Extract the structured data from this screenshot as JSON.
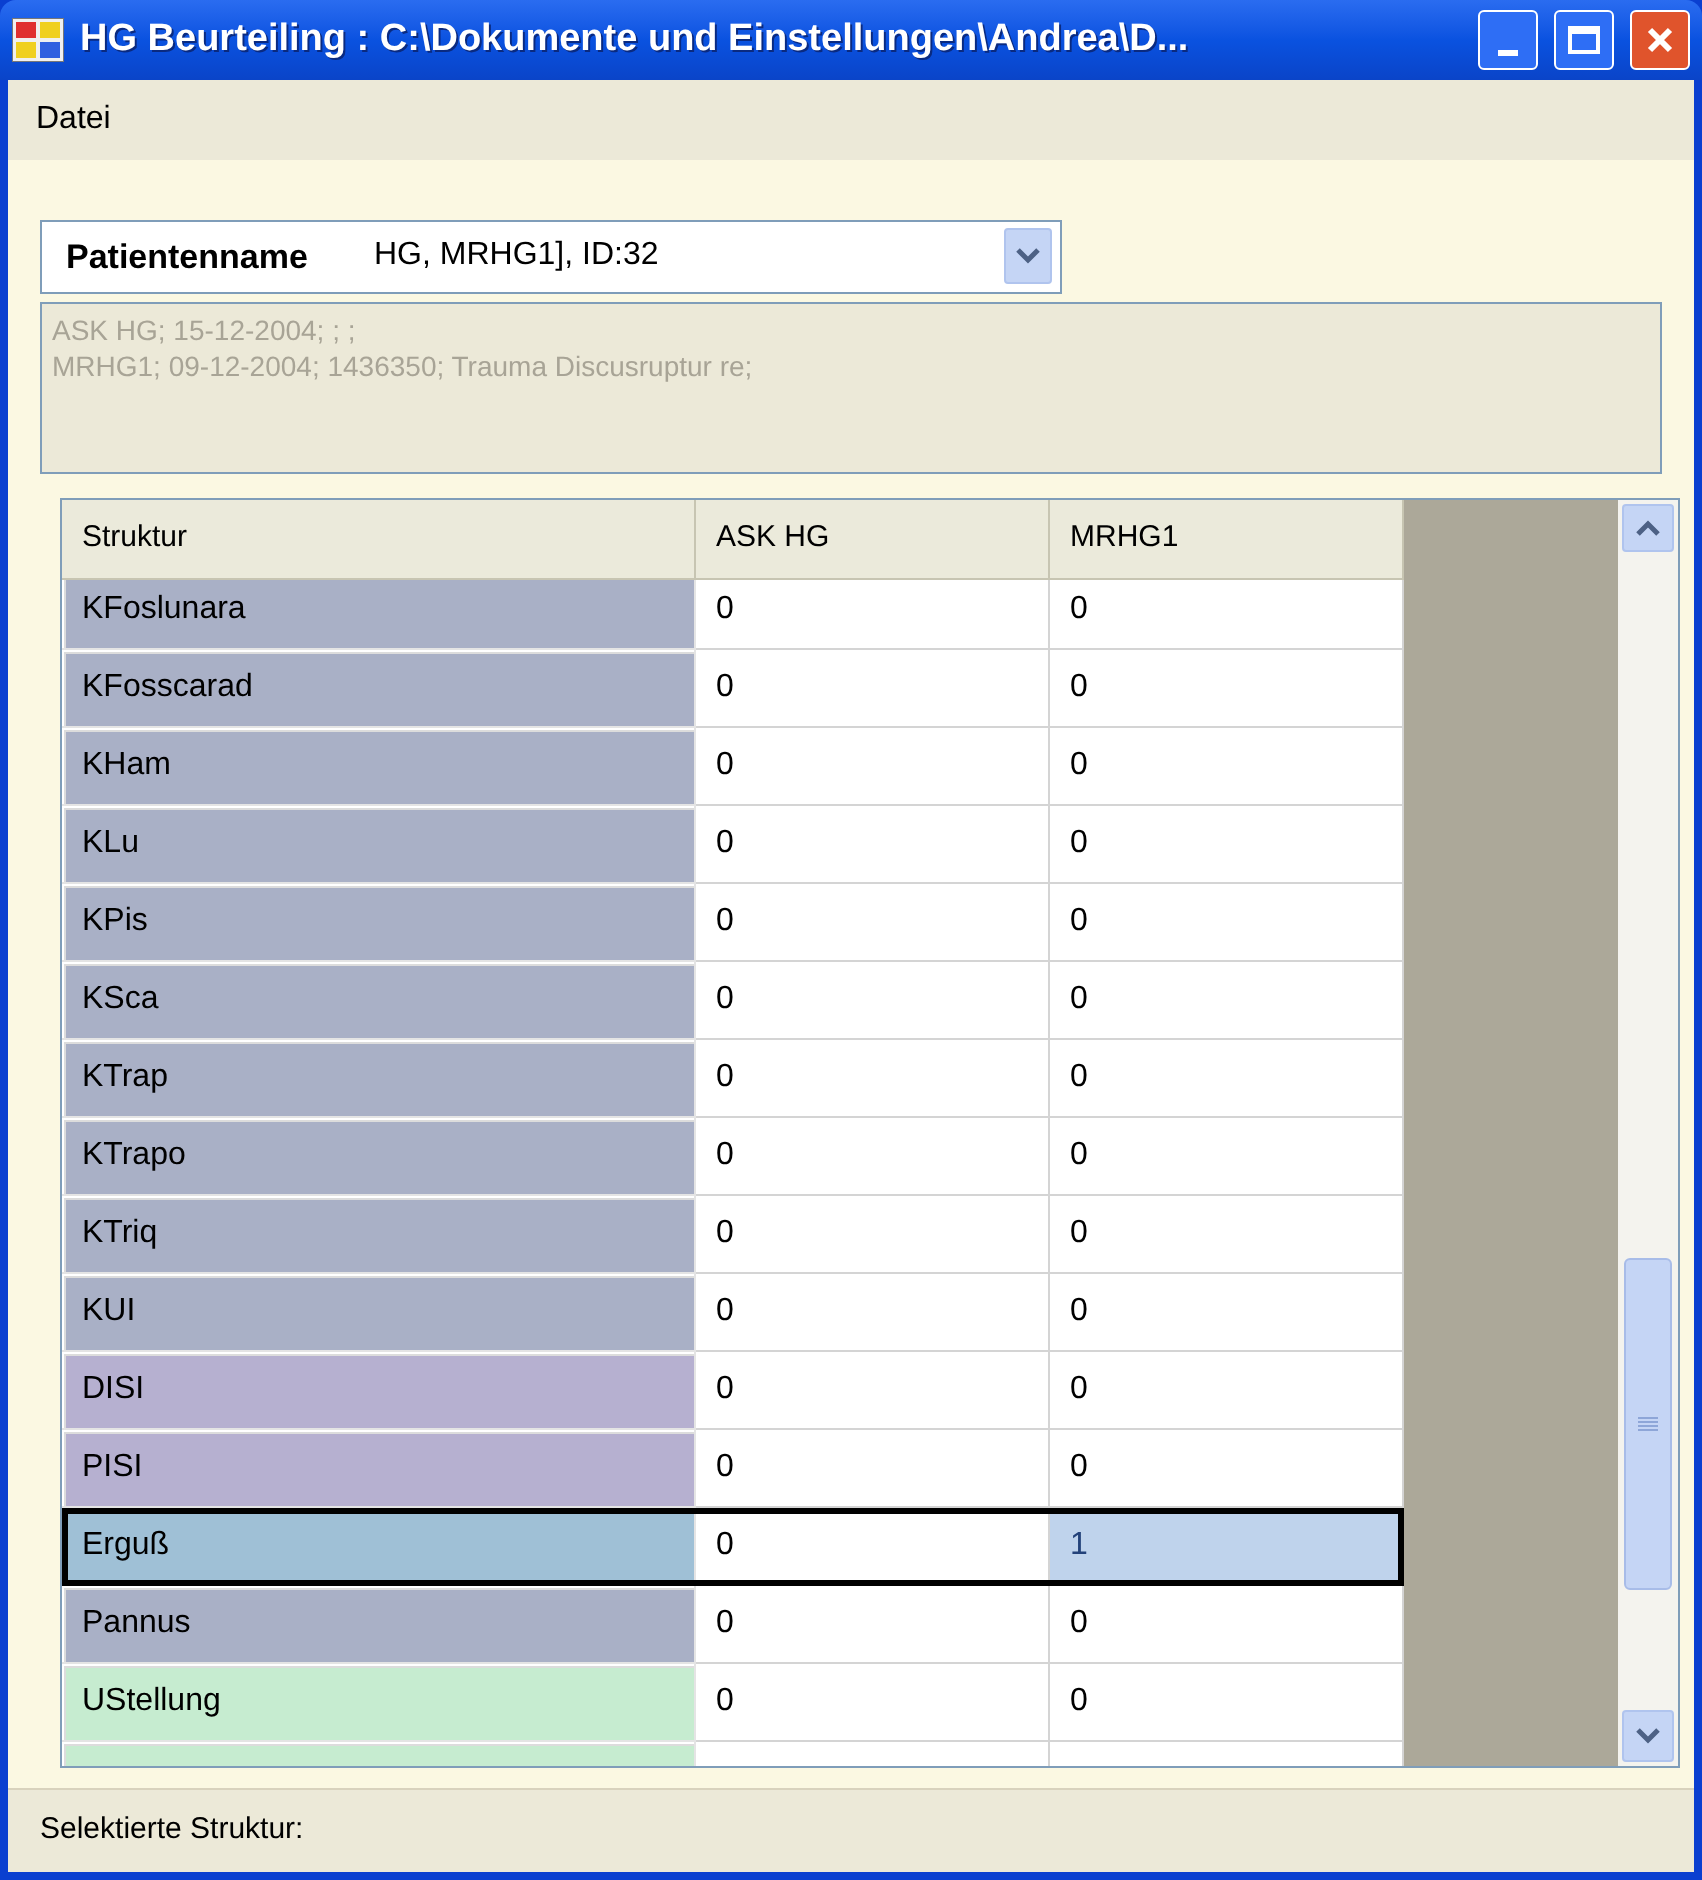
{
  "window": {
    "title": "HG Beurteiling : C:\\Dokumente und Einstellungen\\Andrea\\D..."
  },
  "menu": [
    {
      "label": "Datei"
    }
  ],
  "patient": {
    "label": "Patientenname",
    "value": "HG, MRHG1], ID:32"
  },
  "info_lines": [
    "ASK HG; 15-12-2004; ; ;",
    "MRHG1; 09-12-2004; 1436350; Trauma Discusruptur re;"
  ],
  "grid": {
    "columns": [
      "Struktur",
      "ASK HG",
      "MRHG1"
    ],
    "rows": [
      {
        "name": "KFoslunara",
        "values": [
          "0",
          "0"
        ],
        "color": "#a9b0c6",
        "selected": false
      },
      {
        "name": "KFosscarad",
        "values": [
          "0",
          "0"
        ],
        "color": "#a9b0c6",
        "selected": false
      },
      {
        "name": "KHam",
        "values": [
          "0",
          "0"
        ],
        "color": "#a9b0c6",
        "selected": false
      },
      {
        "name": "KLu",
        "values": [
          "0",
          "0"
        ],
        "color": "#a9b0c6",
        "selected": false
      },
      {
        "name": "KPis",
        "values": [
          "0",
          "0"
        ],
        "color": "#a9b0c6",
        "selected": false
      },
      {
        "name": "KSca",
        "values": [
          "0",
          "0"
        ],
        "color": "#a9b0c6",
        "selected": false
      },
      {
        "name": "KTrap",
        "values": [
          "0",
          "0"
        ],
        "color": "#a9b0c6",
        "selected": false
      },
      {
        "name": "KTrapo",
        "values": [
          "0",
          "0"
        ],
        "color": "#a9b0c6",
        "selected": false
      },
      {
        "name": "KTriq",
        "values": [
          "0",
          "0"
        ],
        "color": "#a9b0c6",
        "selected": false
      },
      {
        "name": "KUI",
        "values": [
          "0",
          "0"
        ],
        "color": "#a9b0c6",
        "selected": false
      },
      {
        "name": "DISI",
        "values": [
          "0",
          "0"
        ],
        "color": "#b6b0d0",
        "selected": false
      },
      {
        "name": "PISI",
        "values": [
          "0",
          "0"
        ],
        "color": "#b6b0d0",
        "selected": false
      },
      {
        "name": "Erguß",
        "values": [
          "0",
          "1"
        ],
        "color": "#9fc0d6",
        "selected": true
      },
      {
        "name": "Pannus",
        "values": [
          "0",
          "0"
        ],
        "color": "#a9b0c6",
        "selected": false
      },
      {
        "name": "UStellung",
        "values": [
          "0",
          "0"
        ],
        "color": "#c6ecd0",
        "selected": false
      },
      {
        "color": "#c6ecd0",
        "selected": false
      }
    ]
  },
  "status_bar": {
    "text": "Selektierte Struktur:"
  }
}
